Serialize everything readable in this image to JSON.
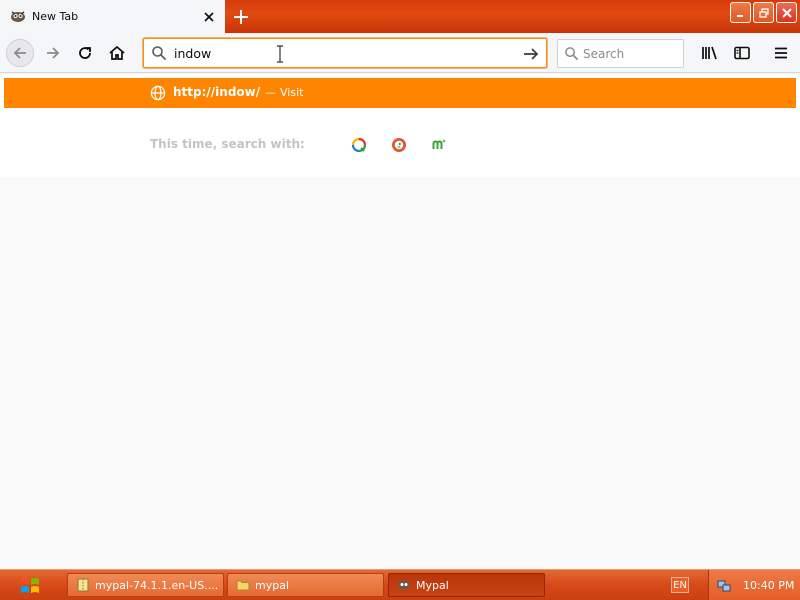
{
  "window": {
    "tab_title": "New Tab",
    "controls": [
      "minimize",
      "restore",
      "close"
    ]
  },
  "navbar": {
    "urlbar_value": "indow",
    "search_placeholder": "Search"
  },
  "popup": {
    "result_url": "http://indow/",
    "result_separator": "—",
    "result_action": "Visit",
    "oneoff_label": "This time, search with:",
    "engines": [
      "engine-1",
      "duckduckgo",
      "engine-3"
    ]
  },
  "taskbar": {
    "tasks": [
      {
        "label": "mypal-74.1.1.en-US...."
      },
      {
        "label": "mypal"
      },
      {
        "label": "Mypal"
      }
    ],
    "language": "EN",
    "clock": "10:40 PM"
  },
  "colors": {
    "accent": "#ff8400",
    "titlebar": "#d63a0a",
    "taskbar": "#d8481a"
  }
}
